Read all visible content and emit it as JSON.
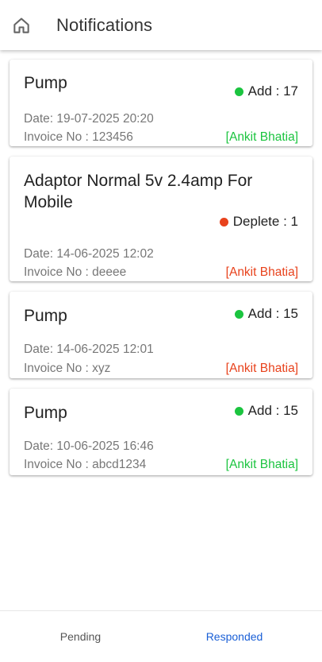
{
  "header": {
    "title": "Notifications",
    "icon": "home-icon"
  },
  "colors": {
    "add": "#1bc43f",
    "deplete": "#e8421c",
    "author_green": "#1bc43f",
    "author_red": "#e8421c",
    "tab_active": "#1a5fd6",
    "tab_inactive": "#555555"
  },
  "notifications": [
    {
      "title": "Pump",
      "status": "add",
      "change_label": "Add : 17",
      "date": "Date: 19-07-2025 20:20",
      "invoice": "Invoice No : 123456",
      "author": "[Ankit Bhatia]",
      "author_color": "green"
    },
    {
      "title": "Adaptor Normal 5v 2.4amp For Mobile",
      "status": "deplete",
      "change_label": "Deplete : 1",
      "date": "Date: 14-06-2025 12:02",
      "invoice": "Invoice No : deeee",
      "author": "[Ankit Bhatia]",
      "author_color": "red"
    },
    {
      "title": "Pump",
      "status": "add",
      "change_label": "Add : 15",
      "date": "Date: 14-06-2025 12:01",
      "invoice": "Invoice No : xyz",
      "author": "[Ankit Bhatia]",
      "author_color": "red"
    },
    {
      "title": "Pump",
      "status": "add",
      "change_label": "Add : 15",
      "date": "Date: 10-06-2025 16:46",
      "invoice": "Invoice No : abcd1234",
      "author": "[Ankit Bhatia]",
      "author_color": "green"
    }
  ],
  "bottom_nav": {
    "tabs": [
      {
        "label": "Pending",
        "active": false
      },
      {
        "label": "Responded",
        "active": true
      }
    ]
  }
}
